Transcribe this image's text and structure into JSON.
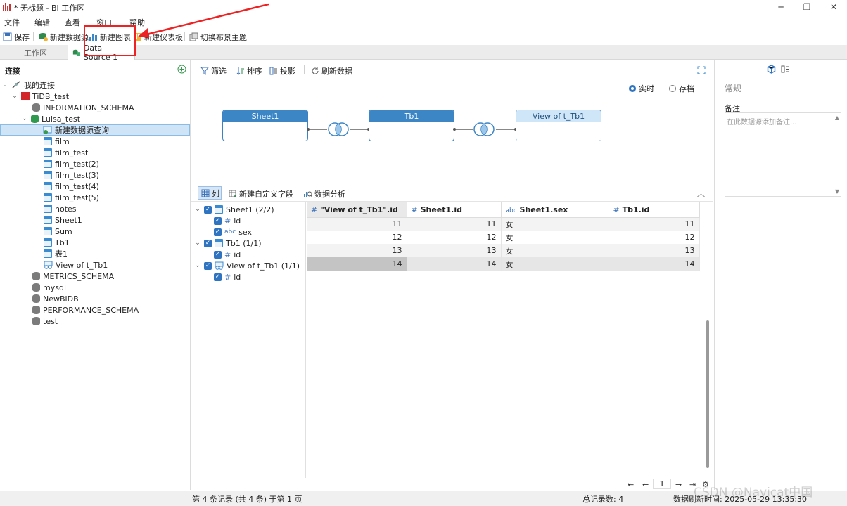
{
  "window": {
    "title": "* 无标题 - BI 工作区",
    "minimize_glyph": "─",
    "maximize_glyph": "❐",
    "close_glyph": "✕"
  },
  "menu": [
    "文件",
    "编辑",
    "查看",
    "窗口",
    "帮助"
  ],
  "toolbar": {
    "save": "保存",
    "new_datasource": "新建数据源",
    "new_chart": "新建图表",
    "new_dashboard": "新建仪表板",
    "switch_theme": "切换布景主题"
  },
  "tabs": [
    "工作区",
    "Data Source 1"
  ],
  "connections": {
    "title": "连接",
    "root": "我的连接",
    "tidb": "TiDB_test",
    "schemas_a": [
      "INFORMATION_SCHEMA"
    ],
    "luisa": "Luisa_test",
    "new_query": "新建数据源查询",
    "tables": [
      "film",
      "film_test",
      "film_test(2)",
      "film_test(3)",
      "film_test(4)",
      "film_test(5)",
      "notes",
      "Sheet1",
      "Sum",
      "Tb1",
      "表1"
    ],
    "view": "View of t_Tb1",
    "schemas_b": [
      "METRICS_SCHEMA",
      "mysql",
      "NewBiDB",
      "PERFORMANCE_SCHEMA",
      "test"
    ]
  },
  "datasource_toolbar": {
    "filter": "筛选",
    "sort": "排序",
    "project": "投影",
    "refresh": "刷新数据"
  },
  "mode": {
    "realtime": "实时",
    "archive": "存档",
    "selected": "实时"
  },
  "diagram": {
    "nodes": [
      "Sheet1",
      "Tb1",
      "View of t_Tb1"
    ]
  },
  "subtoolbar": {
    "columns": "列",
    "new_field": "新建自定义字段",
    "analysis": "数据分析"
  },
  "fields": [
    {
      "group": "Sheet1 (2/2)",
      "items": [
        {
          "name": "id",
          "type": "#"
        },
        {
          "name": "sex",
          "type": "abc"
        }
      ]
    },
    {
      "group": "Tb1 (1/1)",
      "items": [
        {
          "name": "id",
          "type": "#"
        }
      ]
    },
    {
      "group": "View of t_Tb1 (1/1)",
      "items": [
        {
          "name": "id",
          "type": "#"
        }
      ]
    }
  ],
  "grid": {
    "columns": [
      "\"View of t_Tb1\".id",
      "Sheet1.id",
      "Sheet1.sex",
      "Tb1.id"
    ],
    "rows": [
      [
        "11",
        "11",
        "女",
        "11"
      ],
      [
        "12",
        "12",
        "女",
        "12"
      ],
      [
        "13",
        "13",
        "女",
        "13"
      ],
      [
        "14",
        "14",
        "女",
        "14"
      ]
    ]
  },
  "pager": {
    "page": "1"
  },
  "properties": {
    "title": "常规",
    "note_label": "备注",
    "note_placeholder": "在此数据源添加备注..."
  },
  "status": {
    "record": "第 4 条记录 (共 4 条) 于第 1 页",
    "total": "总记录数: 4",
    "refresh": "数据刷新时间: 2025-05-29 13:35:30"
  },
  "watermark": "CSDN @Navicat中国",
  "colors": {
    "accent": "#2f74c0",
    "node_head": "#3d86c6",
    "highlight": "#e22222"
  }
}
